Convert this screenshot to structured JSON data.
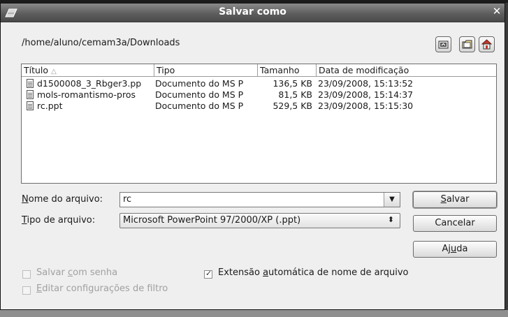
{
  "window": {
    "title": "Salvar como",
    "close_glyph": "✕"
  },
  "path": "/home/aluno/cemam3a/Downloads",
  "nav": {
    "icons": [
      "go-up-folder-icon",
      "new-folder-icon",
      "home-icon"
    ],
    "colors": {
      "home_roof": "#c0392b",
      "folder": "#e8d58c"
    }
  },
  "file_list": {
    "columns": [
      "Título",
      "Tipo",
      "Tamanho",
      "Data de modificação"
    ],
    "sort_indicator": "△",
    "rows": [
      {
        "name": "d1500008_3_Rbger3.pp",
        "type": "Documento do MS P",
        "size": "136,5 KB",
        "modified": "23/09/2008, 15:13:52"
      },
      {
        "name": "mols-romantismo-pros",
        "type": "Documento do MS P",
        "size": "81,5 KB",
        "modified": "23/09/2008, 15:14:37"
      },
      {
        "name": "rc.ppt",
        "type": "Documento do MS P",
        "size": "529,5 KB",
        "modified": "23/09/2008, 15:15:30"
      }
    ]
  },
  "form": {
    "filename_label_u": "N",
    "filename_label_rest": "ome do arquivo:",
    "filename_value": "rc",
    "filetype_label_u": "T",
    "filetype_label_rest": "ipo de arquivo:",
    "filetype_value": "Microsoft PowerPoint 97/2000/XP (.ppt)"
  },
  "buttons": {
    "save_u": "S",
    "save_rest": "alvar",
    "cancel": "Cancelar",
    "help_pre": "Aj",
    "help_u": "u",
    "help_post": "da"
  },
  "options": {
    "password_pre": "Salvar ",
    "password_u": "c",
    "password_post": "om senha",
    "password_checked": false,
    "password_enabled": false,
    "filter_u": "E",
    "filter_post": "ditar configurações de filtro",
    "filter_checked": false,
    "filter_enabled": false,
    "auto_ext_pre": "Extensão ",
    "auto_ext_u": "a",
    "auto_ext_post": "utomática de nome de arquivo",
    "auto_ext_checked": true,
    "check_glyph": "☑"
  }
}
